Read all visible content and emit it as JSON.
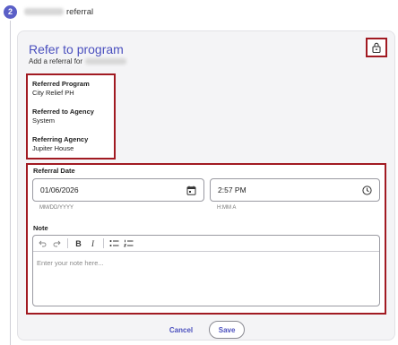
{
  "step": {
    "number": "2",
    "label": "referral"
  },
  "card": {
    "title": "Refer to program",
    "subtitle": "Add a referral for"
  },
  "info": [
    {
      "label": "Referred Program",
      "value": "City Relief PH"
    },
    {
      "label": "Referred to Agency",
      "value": "System"
    },
    {
      "label": "Referring Agency",
      "value": "Jupiter House"
    }
  ],
  "form": {
    "referral_date_label": "Referral Date",
    "date_value": "01/06/2026",
    "date_hint": "MM/DD/YYYY",
    "time_value": "2:57 PM",
    "time_hint": "H:MM A",
    "note_label": "Note",
    "note_placeholder": "Enter your note here..."
  },
  "toolbar": {
    "bold": "B",
    "italic": "I"
  },
  "actions": {
    "cancel": "Cancel",
    "save": "Save"
  },
  "colors": {
    "accent": "#4a4fbe",
    "badge": "#5a5fc7",
    "highlight_border": "#a11a22"
  },
  "icons": [
    "calendar-icon",
    "clock-icon",
    "lock-icon",
    "undo-icon",
    "redo-icon",
    "bullet-list-icon",
    "numbered-list-icon"
  ]
}
